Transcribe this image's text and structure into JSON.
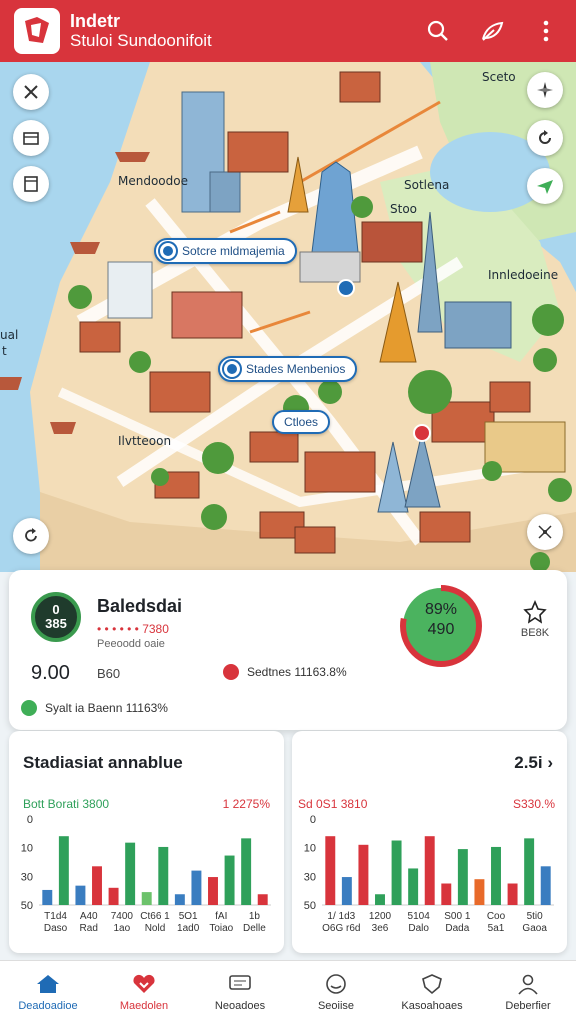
{
  "header": {
    "title": "Indetr",
    "subtitle": "Stuloi Sundoonifoit",
    "icons": [
      "search-icon",
      "leaf-icon",
      "more-vertical-icon"
    ]
  },
  "map": {
    "labels": [
      "Sceto",
      "Mendoodoe",
      "Sotlena",
      "Stoo",
      "Innledoeine",
      "Ilvtteoon",
      "ual",
      "t"
    ],
    "pins": [
      "Sotcre mldmajemia",
      "Stades Menbenios",
      "Ctloes"
    ],
    "controls": [
      "close-icon",
      "layers-icon",
      "bookmark-icon",
      "compass-icon",
      "rotate-icon",
      "navigate-icon",
      "refresh-icon",
      "expand-icon"
    ]
  },
  "summary": {
    "badge_top": "0",
    "badge_bottom": "385",
    "title": "Baledsdai",
    "dots_text": "• • • • • • 7380",
    "sub_text": "Peeoodd oaie",
    "big_value": "9.00",
    "big_sub": "B60",
    "legend_red": "Sedtnes 11163.8%",
    "legend_green": "Syalt ia Baenn 11163%",
    "gauge_top": "89%",
    "gauge_bottom": "490",
    "gauge_level": 0.78,
    "award_label": "BE8K",
    "colors": {
      "red": "#d8343c",
      "green": "#3fae57"
    }
  },
  "stats_left": {
    "title": "Stadiasiat annablue",
    "head_left": "Bott Borati 3800",
    "head_right": "1 2275%"
  },
  "stats_right": {
    "head": "2.5i",
    "head_left": "Sd 0S1 3810",
    "head_right": "S330.%"
  },
  "chart_data": [
    {
      "type": "bar",
      "ylim": [
        0,
        40
      ],
      "yticks": [
        "0",
        "10",
        "30",
        "50"
      ],
      "categories": [
        "T1d4 Daso",
        "A40 Rad",
        "7400 1ao",
        "Ct66 1 Nold",
        "5O1 1ad0",
        "fAI Toiao",
        "1b Delle"
      ],
      "colors": [
        "#3a7dc0",
        "#2fa05a",
        "#3a7dc0",
        "#d8343c",
        "#d8343c",
        "#2fa05a",
        "#6cc26b",
        "#2fa05a",
        "#3a7dc0",
        "#3a7dc0",
        "#d8343c",
        "#2fa05a",
        "#2fa05a",
        "#d8343c"
      ],
      "values": [
        7,
        32,
        9,
        18,
        8,
        29,
        6,
        27,
        5,
        16,
        13,
        23,
        31,
        5
      ]
    },
    {
      "type": "bar",
      "ylim": [
        0,
        40
      ],
      "yticks": [
        "0",
        "10",
        "30",
        "50"
      ],
      "categories": [
        "1/ 1d3 O6G r6d",
        "1200 3e6",
        "5104 Dalo",
        "S00 1 Dada",
        "Coo 5a1",
        "5ti0 Gaoa"
      ],
      "colors": [
        "#d8343c",
        "#3a7dc0",
        "#d8343c",
        "#2fa05a",
        "#2fa05a",
        "#2fa05a",
        "#d8343c",
        "#d8343c",
        "#2fa05a",
        "#e86a2a",
        "#2fa05a",
        "#d8343c",
        "#2fa05a",
        "#3a7dc0"
      ],
      "values": [
        32,
        13,
        28,
        5,
        30,
        17,
        32,
        10,
        26,
        12,
        27,
        10,
        31,
        18
      ]
    }
  ],
  "nav": [
    {
      "label": "Deadoadioe",
      "icon": "home-icon"
    },
    {
      "label": "Maedolen",
      "icon": "heart-icon"
    },
    {
      "label": "Neoadoes",
      "icon": "message-icon"
    },
    {
      "label": "Seoiise",
      "icon": "smiley-icon"
    },
    {
      "label": "Kasoahoaes",
      "icon": "shield-icon"
    },
    {
      "label": "Deberfier",
      "icon": "user-icon"
    }
  ]
}
